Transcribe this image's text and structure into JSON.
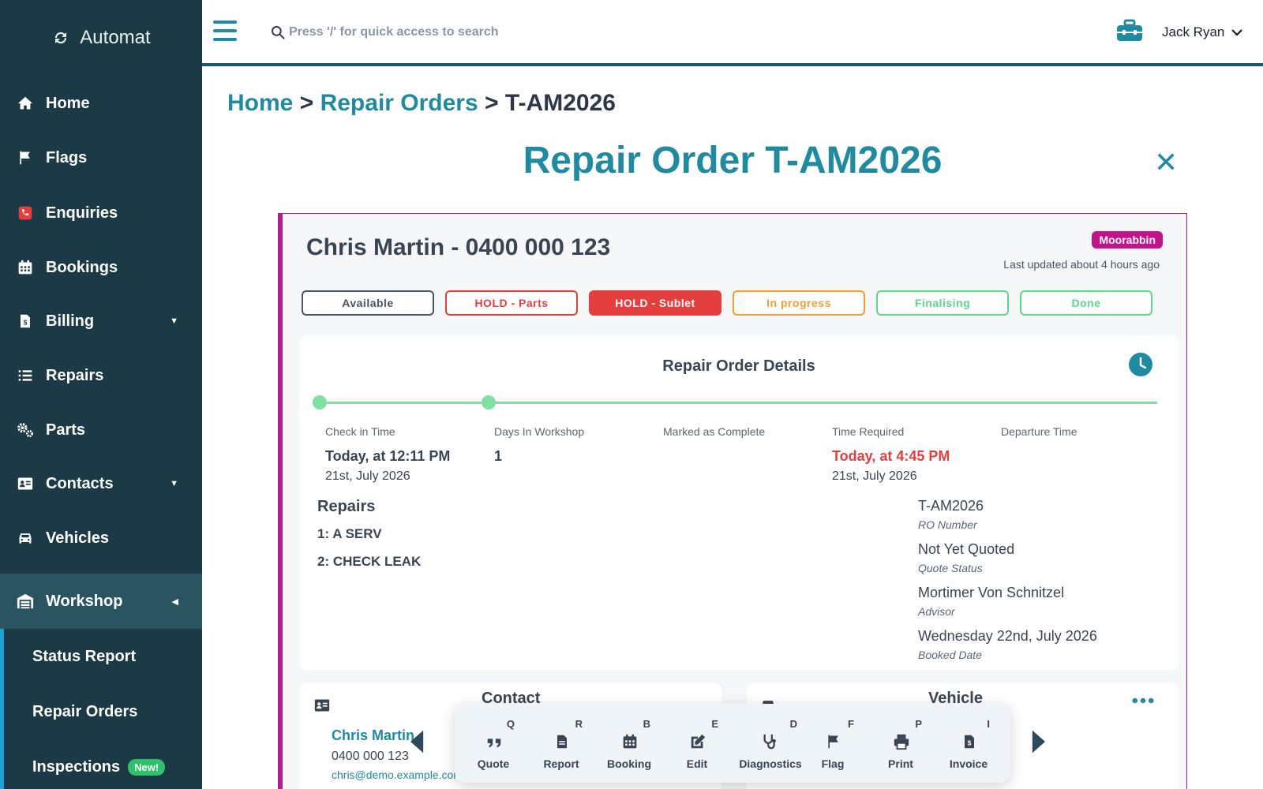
{
  "brand": {
    "name": "Automat"
  },
  "sidebar": {
    "items": [
      {
        "label": "Home",
        "icon": "home-icon"
      },
      {
        "label": "Flags",
        "icon": "flag-icon"
      },
      {
        "label": "Enquiries",
        "icon": "phone-icon"
      },
      {
        "label": "Bookings",
        "icon": "calendar-icon"
      },
      {
        "label": "Billing",
        "icon": "invoice-icon",
        "caret": "▼"
      },
      {
        "label": "Repairs",
        "icon": "list-icon"
      },
      {
        "label": "Parts",
        "icon": "gears-icon"
      },
      {
        "label": "Contacts",
        "icon": "contact-card-icon",
        "caret": "▼"
      },
      {
        "label": "Vehicles",
        "icon": "car-icon"
      },
      {
        "label": "Workshop",
        "icon": "warehouse-icon",
        "caret": "◀"
      }
    ],
    "subitems": [
      {
        "label": "Status Report"
      },
      {
        "label": "Repair Orders"
      },
      {
        "label": "Inspections",
        "badge": "New!"
      }
    ]
  },
  "topbar": {
    "search_placeholder": "Press '/' for quick access to search",
    "user_name": "Jack Ryan"
  },
  "breadcrumb": {
    "home": "Home",
    "sep1": ">",
    "repair_orders": "Repair Orders",
    "sep2": ">",
    "current": "T-AM2026"
  },
  "page": {
    "title": "Repair Order T-AM2026",
    "close": "✕"
  },
  "ro": {
    "customer_title": "Chris Martin - 0400 000 123",
    "location": "Moorabbin",
    "last_updated": "Last updated about 4 hours ago",
    "statuses": [
      {
        "label": "Available",
        "color": "#4a5563",
        "fill": false
      },
      {
        "label": "HOLD - Parts",
        "color": "#e53e3e",
        "fill": false
      },
      {
        "label": "HOLD - Sublet",
        "color": "#e53e3e",
        "fill": true
      },
      {
        "label": "In progress",
        "color": "#f0a030",
        "fill": false
      },
      {
        "label": "Finalising",
        "color": "#5cd68a",
        "fill": false
      },
      {
        "label": "Done",
        "color": "#5cd68a",
        "fill": false
      }
    ],
    "details": {
      "title": "Repair Order Details",
      "timeline": [
        {
          "label": "Check in Time",
          "value": "Today, at 12:11 PM",
          "sub": "21st, July 2026"
        },
        {
          "label": "Days In Workshop",
          "value": "1",
          "sub": ""
        },
        {
          "label": "Marked as Complete",
          "value": "",
          "sub": ""
        },
        {
          "label": "Time Required",
          "value": "Today, at 4:45 PM",
          "sub": "21st, July 2026",
          "alert": true
        },
        {
          "label": "Departure Time",
          "value": "",
          "sub": ""
        }
      ],
      "repairs_heading": "Repairs",
      "repairs": [
        "1: A SERV",
        "2: CHECK LEAK"
      ],
      "info": [
        {
          "value": "T-AM2026",
          "label": "RO Number"
        },
        {
          "value": "Not Yet Quoted",
          "label": "Quote Status"
        },
        {
          "value": "Mortimer Von Schnitzel",
          "label": "Advisor"
        },
        {
          "value": "Wednesday 22nd, July 2026",
          "label": "Booked Date"
        }
      ]
    },
    "contact": {
      "heading": "Contact",
      "name": "Chris Martin",
      "phone": "0400 000 123",
      "email": "chris@demo.example.com"
    },
    "vehicle": {
      "heading": "Vehicle"
    }
  },
  "actions": [
    {
      "label": "Quote",
      "key": "Q",
      "icon": "quote-icon"
    },
    {
      "label": "Report",
      "key": "R",
      "icon": "report-icon"
    },
    {
      "label": "Booking",
      "key": "B",
      "icon": "calendar-icon"
    },
    {
      "label": "Edit",
      "key": "E",
      "icon": "edit-icon"
    },
    {
      "label": "Diagnostics",
      "key": "D",
      "icon": "stethoscope-icon"
    },
    {
      "label": "Flag",
      "key": "F",
      "icon": "flag-icon"
    },
    {
      "label": "Print",
      "key": "P",
      "icon": "print-icon"
    },
    {
      "label": "Invoice",
      "key": "I",
      "icon": "invoice-icon"
    }
  ],
  "colors": {
    "accent": "#1e8ba0",
    "sidebar": "#1b3a46",
    "ro_border": "#b31b8f"
  }
}
